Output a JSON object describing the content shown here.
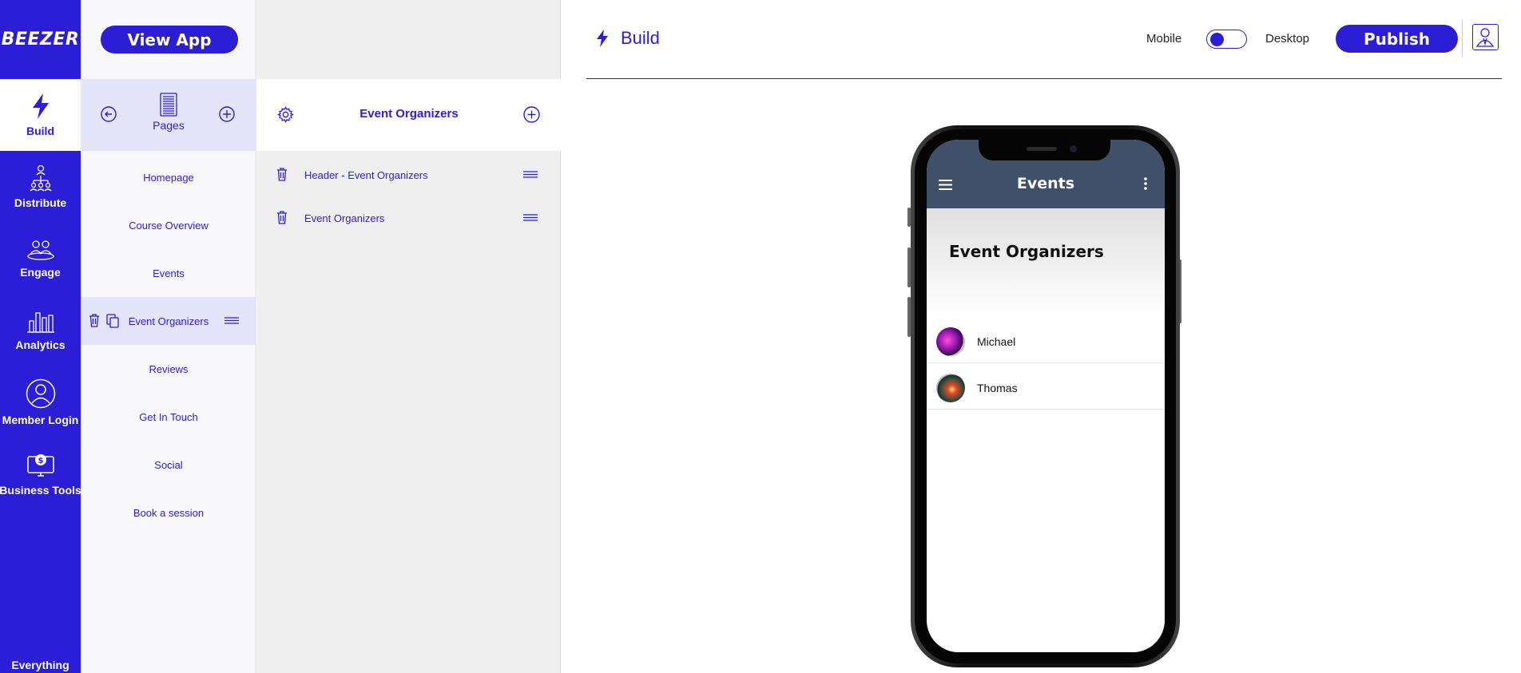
{
  "brand": {
    "logo_text": "BEEZER"
  },
  "leftnav": {
    "items": [
      {
        "label": "Build",
        "icon": "lightning-icon"
      },
      {
        "label": "Distribute",
        "icon": "distribute-icon"
      },
      {
        "label": "Engage",
        "icon": "engage-icon"
      },
      {
        "label": "Analytics",
        "icon": "bar-chart-icon"
      },
      {
        "label": "Member Login",
        "icon": "user-circle-icon"
      },
      {
        "label": "Business Tools",
        "icon": "monitor-dollar-icon"
      },
      {
        "label": "Everything"
      }
    ]
  },
  "pages_panel": {
    "view_app_label": "View App",
    "header_label": "Pages",
    "pages": [
      {
        "label": "Homepage"
      },
      {
        "label": "Course Overview"
      },
      {
        "label": "Events"
      },
      {
        "label": "Event Organizers"
      },
      {
        "label": "Reviews"
      },
      {
        "label": "Get In Touch"
      },
      {
        "label": "Social"
      },
      {
        "label": "Book a session"
      }
    ]
  },
  "section_panel": {
    "title": "Event Organizers",
    "sections": [
      {
        "label": "Header - Event Organizers"
      },
      {
        "label": "Event Organizers"
      }
    ]
  },
  "topbar": {
    "build_label": "Build",
    "mobile_label": "Mobile",
    "desktop_label": "Desktop",
    "publish_label": "Publish"
  },
  "preview": {
    "app_bar_title": "Events",
    "hero_title": "Event Organizers",
    "organizers": [
      {
        "name": "Michael"
      },
      {
        "name": "Thomas"
      }
    ]
  },
  "colors": {
    "accent": "#2b1ed6",
    "app_bar": "#3f5068"
  }
}
